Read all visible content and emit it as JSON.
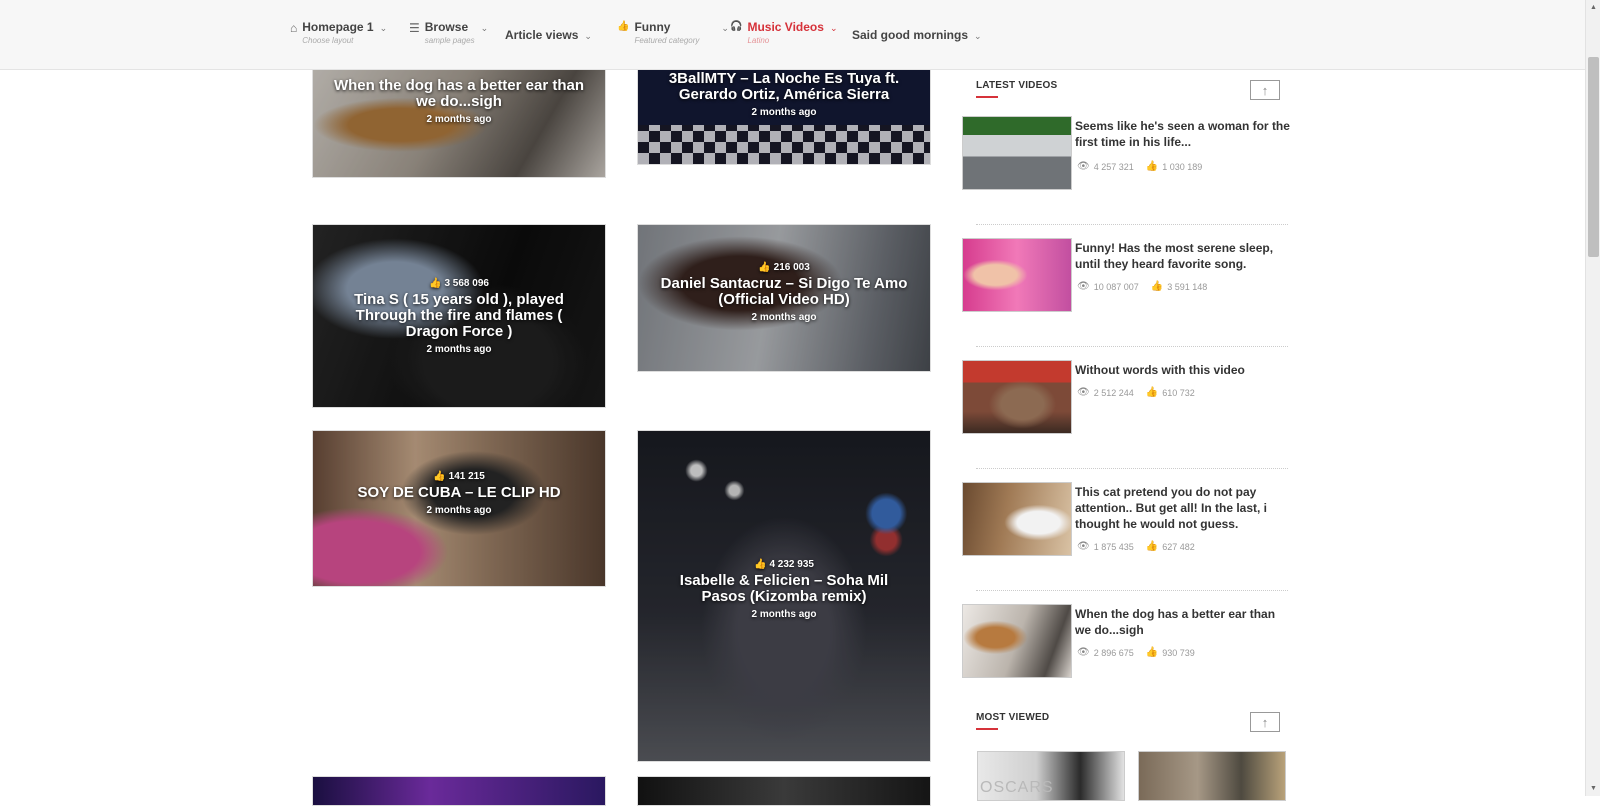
{
  "nav": {
    "items": [
      {
        "icon": "home-icon",
        "glyph": "⌂",
        "label": "Homepage 1",
        "sub": "Choose layout"
      },
      {
        "icon": "list-icon",
        "glyph": "☰",
        "label": "Browse",
        "sub": "sample pages"
      },
      {
        "label": "Article views"
      },
      {
        "icon": "thumbs-up-icon",
        "glyph": "👍",
        "label": "Funny",
        "sub": "Featured category"
      },
      {
        "icon": "headphones-icon",
        "glyph": "🎧",
        "label": "Music Videos",
        "sub": "Latino",
        "active": true
      },
      {
        "label": "Said good mornings"
      }
    ]
  },
  "grid": [
    {
      "title": "When the dog has a better ear than we do...sigh",
      "time": "2 months ago"
    },
    {
      "title": "3BallMTY – La Noche Es Tuya ft. Gerardo Ortiz, América Sierra",
      "time": "2 months ago"
    },
    {
      "likes": "3 568 096",
      "title": "Tina S ( 15 years old ), played Through the fire and flames ( Dragon Force )",
      "time": "2 months ago"
    },
    {
      "likes": "216 003",
      "title": "Daniel Santacruz – Si Digo Te Amo (Official Video HD)",
      "time": "2 months ago"
    },
    {
      "likes": "141 215",
      "title": "SOY DE CUBA – LE CLIP HD",
      "time": "2 months ago"
    },
    {
      "likes": "4 232 935",
      "title": "Isabelle & Felicien – Soha Mil Pasos (Kizomba remix)",
      "time": "2 months ago"
    }
  ],
  "sidebar": {
    "latest_heading": "LATEST VIDEOS",
    "latest": [
      {
        "title": "Seems like he's seen a woman for the first time in his life...",
        "views": "4 257 321",
        "likes": "1 030 189"
      },
      {
        "title": "Funny! Has the most serene sleep, until they heard favorite song.",
        "views": "10 087 007",
        "likes": "3 591 148"
      },
      {
        "title": "Without words with this video",
        "views": "2 512 244",
        "likes": "610 732"
      },
      {
        "title": "This cat pretend you do not pay attention.. But get all! In the last, i thought he would not guess.",
        "views": "1 875 435",
        "likes": "627 482"
      },
      {
        "title": "When the dog has a better ear than we do...sigh",
        "views": "2 896 675",
        "likes": "930 739"
      }
    ],
    "most_heading": "MOST VIEWED",
    "oscars_text": "OSCARS"
  },
  "icons": {
    "eye": "👁",
    "like": "👍",
    "arrow_up": "↑",
    "chevron": "⌄"
  },
  "colors": {
    "accent": "#d6323a"
  }
}
